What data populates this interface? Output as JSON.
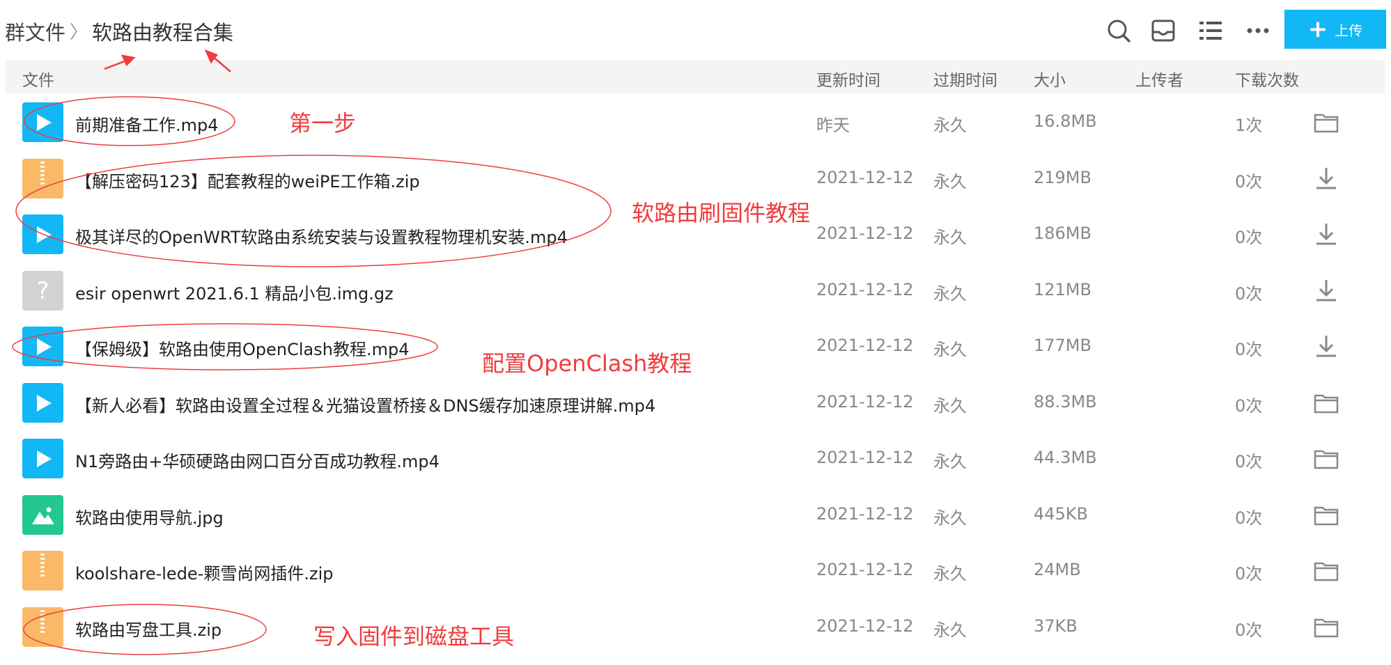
{
  "breadcrumb": {
    "root": "群文件",
    "separator": "〉",
    "current": "软路由教程合集"
  },
  "toolbar": {
    "icons": [
      "search-icon",
      "inbox-icon",
      "list-view-icon",
      "more-icon"
    ],
    "upload_label": "上传",
    "accent_color": "#12b7f5"
  },
  "table": {
    "columns": {
      "file": "文件",
      "updated": "更新时间",
      "expires": "过期时间",
      "size": "大小",
      "uploader": "上传者",
      "downloads": "下载次数"
    },
    "rows": [
      {
        "icon": "video",
        "name": "前期准备工作.mp4",
        "updated": "昨天",
        "expires": "永久",
        "size": "16.8MB",
        "uploader": "",
        "downloads": "1次",
        "action": "folder-icon"
      },
      {
        "icon": "zip",
        "name": "【解压密码123】配套教程的weiPE工作箱.zip",
        "updated": "2021-12-12",
        "expires": "永久",
        "size": "219MB",
        "uploader": "",
        "downloads": "0次",
        "action": "download-icon"
      },
      {
        "icon": "video",
        "name": "极其详尽的OpenWRT软路由系统安装与设置教程物理机安装.mp4",
        "updated": "2021-12-12",
        "expires": "永久",
        "size": "186MB",
        "uploader": "",
        "downloads": "0次",
        "action": "download-icon"
      },
      {
        "icon": "unknown",
        "name": "esir openwrt 2021.6.1 精品小包.img.gz",
        "updated": "2021-12-12",
        "expires": "永久",
        "size": "121MB",
        "uploader": "",
        "downloads": "0次",
        "action": "download-icon"
      },
      {
        "icon": "video",
        "name": "【保姆级】软路由使用OpenClash教程.mp4",
        "updated": "2021-12-12",
        "expires": "永久",
        "size": "177MB",
        "uploader": "",
        "downloads": "0次",
        "action": "download-icon"
      },
      {
        "icon": "video",
        "name": "【新人必看】软路由设置全过程＆光猫设置桥接＆DNS缓存加速原理讲解.mp4",
        "updated": "2021-12-12",
        "expires": "永久",
        "size": "88.3MB",
        "uploader": "",
        "downloads": "0次",
        "action": "folder-icon"
      },
      {
        "icon": "video",
        "name": "N1旁路由+华硕硬路由网口百分百成功教程.mp4",
        "updated": "2021-12-12",
        "expires": "永久",
        "size": "44.3MB",
        "uploader": "",
        "downloads": "0次",
        "action": "folder-icon"
      },
      {
        "icon": "image",
        "name": "软路由使用导航.jpg",
        "updated": "2021-12-12",
        "expires": "永久",
        "size": "445KB",
        "uploader": "",
        "downloads": "0次",
        "action": "folder-icon"
      },
      {
        "icon": "zip",
        "name": "koolshare-lede-颗雪尚网插件.zip",
        "updated": "2021-12-12",
        "expires": "永久",
        "size": "24MB",
        "uploader": "",
        "downloads": "0次",
        "action": "folder-icon"
      },
      {
        "icon": "zip",
        "name": "软路由写盘工具.zip",
        "updated": "2021-12-12",
        "expires": "永久",
        "size": "37KB",
        "uploader": "",
        "downloads": "0次",
        "action": "folder-icon"
      }
    ]
  },
  "annotations": {
    "step1": "第一步",
    "flash": "软路由刷固件教程",
    "openclash": "配置OpenClash教程",
    "write_disk": "写入固件到磁盘工具",
    "color": "#f03c3c"
  }
}
